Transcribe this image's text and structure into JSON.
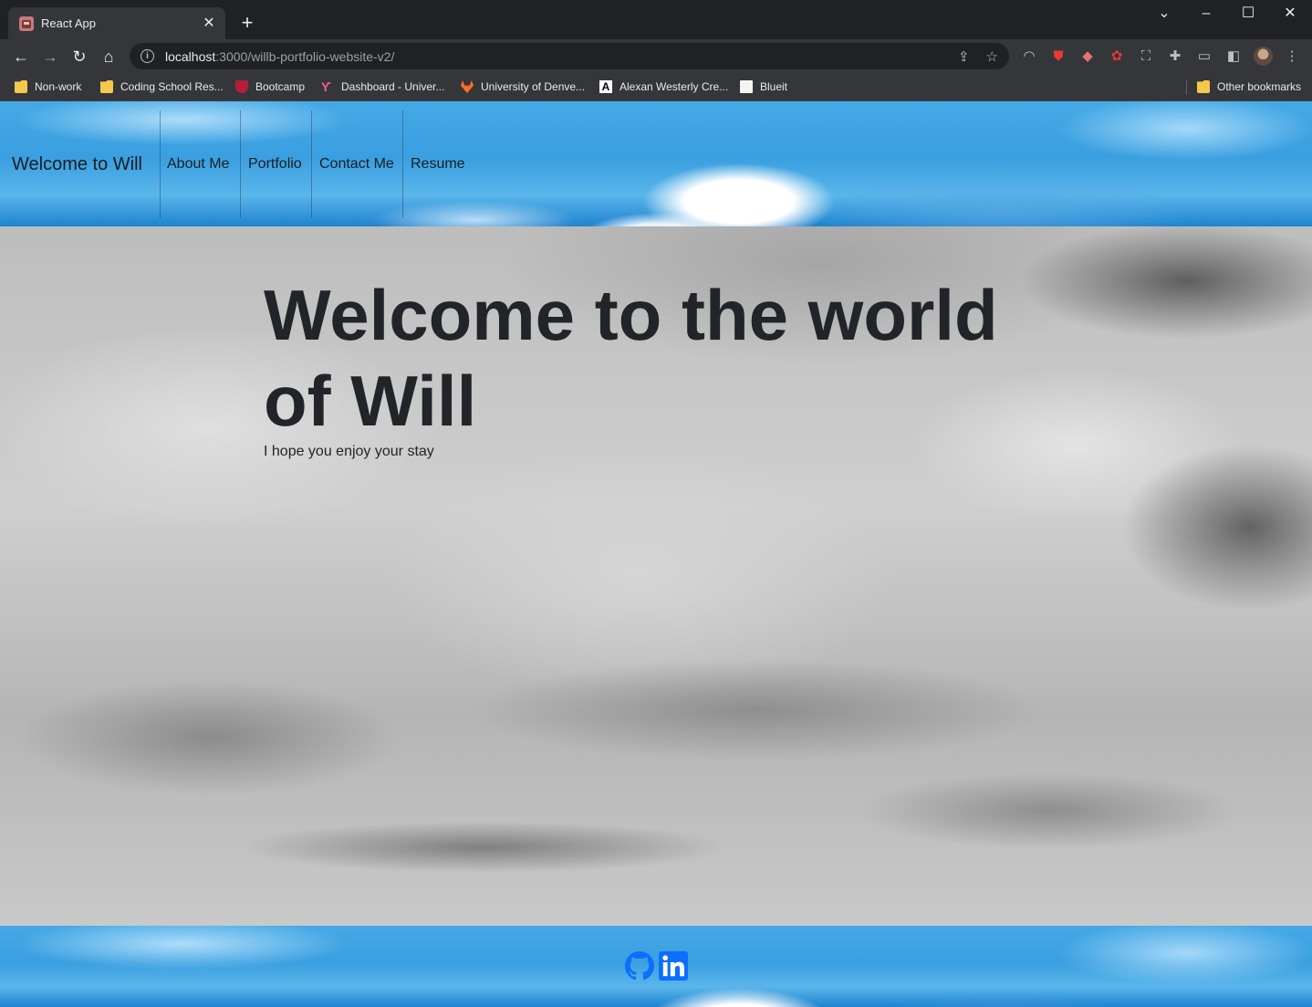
{
  "browser": {
    "tab_title": "React App",
    "tab_close": "✕",
    "new_tab": "+",
    "url_host": "localhost",
    "url_path": ":3000/willb-portfolio-website-v2/",
    "bookmarks": [
      {
        "label": "Non-work",
        "icon": "folder-icon"
      },
      {
        "label": "Coding School Res...",
        "icon": "folder-icon"
      },
      {
        "label": "Bootcamp",
        "icon": "shield-icon"
      },
      {
        "label": "Dashboard - Univer...",
        "icon": "yelp-like-icon"
      },
      {
        "label": "University of Denve...",
        "icon": "gitlab-icon"
      },
      {
        "label": "Alexan Westerly Cre...",
        "icon": "a-logo-icon"
      },
      {
        "label": "Blueit",
        "icon": "page-icon"
      }
    ],
    "other_bookmarks": "Other bookmarks"
  },
  "page": {
    "brand": "Welcome to Will",
    "nav": [
      "About Me",
      "Portfolio",
      "Contact Me",
      "Resume"
    ],
    "hero_title": "Welcome to the world of Will",
    "hero_subtitle": "I hope you enjoy your stay"
  },
  "colors": {
    "accent_link": "#0d6efd",
    "text_dark": "#212529"
  }
}
